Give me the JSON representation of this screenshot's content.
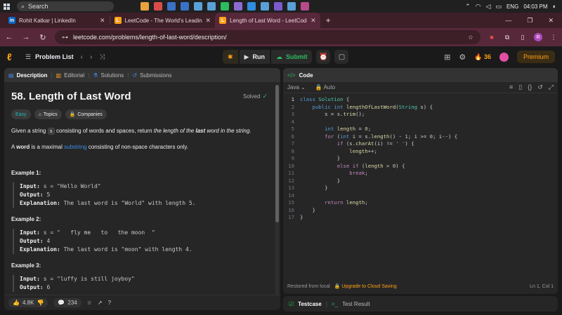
{
  "taskbar": {
    "search_placeholder": "Search",
    "lang": "ENG",
    "time": "04:03 PM",
    "apps": [
      {
        "name": "chrome-app",
        "color": "#e8a33d"
      },
      {
        "name": "app-2",
        "color": "#d94b4b"
      },
      {
        "name": "app-3",
        "color": "#3a72c8"
      },
      {
        "name": "app-4",
        "color": "#3a72c8"
      },
      {
        "name": "app-5",
        "color": "#5aa0d8"
      },
      {
        "name": "app-6",
        "color": "#5aa0d8"
      },
      {
        "name": "app-7",
        "color": "#2cbb5d"
      },
      {
        "name": "app-8",
        "color": "#8a6bd1"
      },
      {
        "name": "vscode-app",
        "color": "#2f8ee0"
      },
      {
        "name": "app-10",
        "color": "#5aa0d8"
      },
      {
        "name": "app-11",
        "color": "#7a5acd"
      },
      {
        "name": "app-12",
        "color": "#5aa0d8"
      },
      {
        "name": "app-13",
        "color": "#b84a8a"
      }
    ]
  },
  "browser": {
    "tabs": [
      {
        "title": "Rohit Katkar | LinkedIn",
        "icon": "linkedin-icon",
        "color": "#0a66c2",
        "glyph": "in"
      },
      {
        "title": "LeetCode - The World's Leading",
        "icon": "leetcode-icon",
        "color": "#ffa116",
        "glyph": "L"
      },
      {
        "title": "Length of Last Word - LeetCode",
        "icon": "leetcode-icon",
        "color": "#ffa116",
        "glyph": "L"
      }
    ],
    "url": "leetcode.com/problems/length-of-last-word/description/"
  },
  "lcnav": {
    "problem_list": "Problem List",
    "run": "Run",
    "submit": "Submit",
    "streak": "36",
    "premium": "Premium"
  },
  "left": {
    "tabs": {
      "description": "Description",
      "editorial": "Editorial",
      "solutions": "Solutions",
      "submissions": "Submissions"
    },
    "title": "58. Length of Last Word",
    "solved": "Solved",
    "tags": {
      "easy": "Easy",
      "topics": "Topics",
      "companies": "Companies"
    },
    "para1": {
      "a": "Given a string ",
      "code": "s",
      "b": " consisting of words and spaces, return ",
      "c": "the length of the ",
      "d": "last",
      "e": " word in the string."
    },
    "para2": {
      "a": "A ",
      "word": "word",
      "b": " is a maximal ",
      "link": "substring",
      "c": " consisting of non-space characters only."
    },
    "examples": [
      {
        "title": "Example 1:",
        "input": "s = \"Hello World\"",
        "output": "5",
        "explanation": "The last word is \"World\" with length 5."
      },
      {
        "title": "Example 2:",
        "input": "s = \"   fly me   to   the moon  \"",
        "output": "4",
        "explanation": "The last word is \"moon\" with length 4."
      },
      {
        "title": "Example 3:",
        "input": "s = \"luffy is still joyboy\"",
        "output": "6"
      }
    ],
    "labels": {
      "input": "Input:",
      "output": "Output:",
      "explanation": "Explanation:"
    },
    "footer": {
      "likes": "4.8K",
      "comments": "234"
    }
  },
  "right": {
    "code_title": "Code",
    "language": "Java",
    "auto": "Auto",
    "lines": [
      "class Solution {",
      "    public int lengthOfLastWord(String s) {",
      "        s = s.trim();",
      "",
      "        int length = 0;",
      "        for (int i = s.length() - 1; i >= 0; i--) {",
      "            if (s.charAt(i) != ' ') {",
      "                length++;",
      "            }",
      "            else if (length > 0) {",
      "                break;",
      "            }",
      "        }",
      "",
      "        return length;",
      "    }",
      "}"
    ],
    "footer": {
      "restored": "Restored from local",
      "upgrade": "Upgrade to Cloud Saving",
      "position": "Ln 1, Col 1"
    },
    "testcase": "Testcase",
    "test_result": "Test Result"
  },
  "colors": {
    "accent": "#ffa116",
    "green": "#2cbb5d",
    "link": "#3b8ee6"
  }
}
